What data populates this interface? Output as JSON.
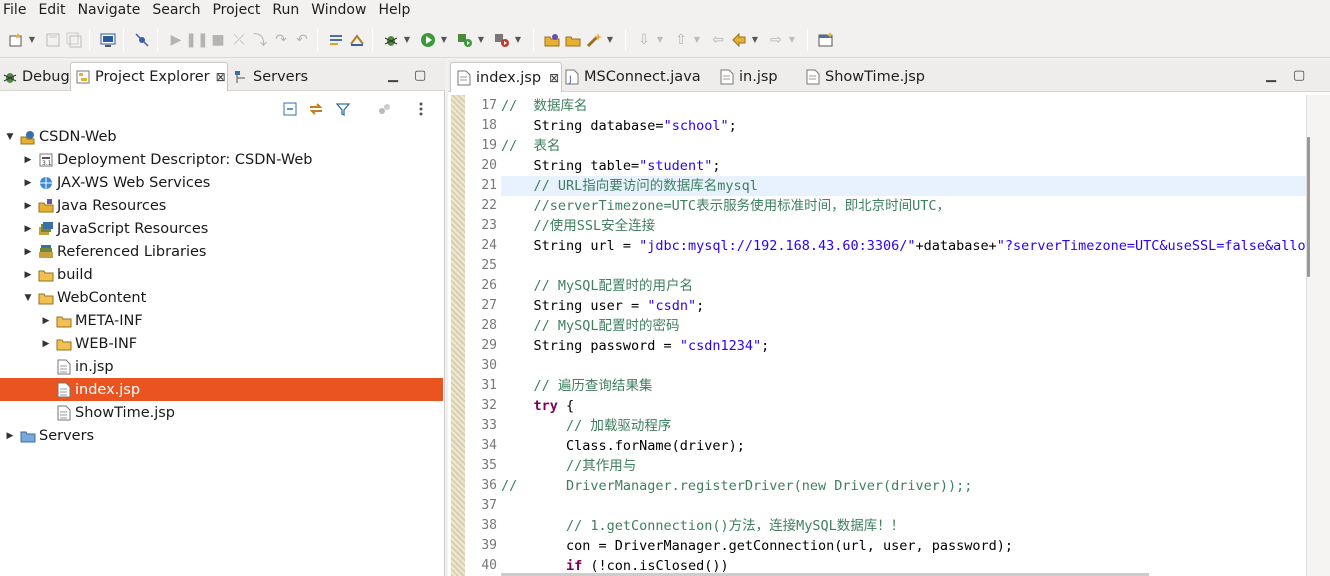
{
  "menubar": [
    "File",
    "Edit",
    "Navigate",
    "Search",
    "Project",
    "Run",
    "Window",
    "Help"
  ],
  "left_panel": {
    "tabs": [
      {
        "label": "Debug",
        "icon": "debug-icon"
      },
      {
        "label": "Project Explorer",
        "icon": "project-explorer-icon",
        "close": "⊠"
      },
      {
        "label": "Servers",
        "icon": "servers-icon"
      }
    ],
    "tree": [
      {
        "label": "CSDN-Web",
        "depth": 0,
        "arrow": "▼",
        "icon": "web-project-icon"
      },
      {
        "label": "Deployment Descriptor: CSDN-Web",
        "depth": 1,
        "arrow": "▶",
        "icon": "deployment-descriptor-icon"
      },
      {
        "label": "JAX-WS Web Services",
        "depth": 1,
        "arrow": "▶",
        "icon": "web-services-icon"
      },
      {
        "label": "Java Resources",
        "depth": 1,
        "arrow": "▶",
        "icon": "java-resources-icon"
      },
      {
        "label": "JavaScript Resources",
        "depth": 1,
        "arrow": "▶",
        "icon": "javascript-resources-icon"
      },
      {
        "label": "Referenced Libraries",
        "depth": 1,
        "arrow": "▶",
        "icon": "libraries-icon"
      },
      {
        "label": "build",
        "depth": 1,
        "arrow": "▶",
        "icon": "folder-icon"
      },
      {
        "label": "WebContent",
        "depth": 1,
        "arrow": "▼",
        "icon": "folder-icon"
      },
      {
        "label": "META-INF",
        "depth": 2,
        "arrow": "▶",
        "icon": "folder-icon"
      },
      {
        "label": "WEB-INF",
        "depth": 2,
        "arrow": "▶",
        "icon": "folder-icon"
      },
      {
        "label": "in.jsp",
        "depth": 2,
        "arrow": "",
        "icon": "file-icon"
      },
      {
        "label": "index.jsp",
        "depth": 2,
        "arrow": "",
        "icon": "file-icon",
        "selected": true
      },
      {
        "label": "ShowTime.jsp",
        "depth": 2,
        "arrow": "",
        "icon": "file-icon"
      },
      {
        "label": "Servers",
        "depth": 0,
        "arrow": "▶",
        "icon": "servers-folder-icon"
      }
    ]
  },
  "editor": {
    "tabs": [
      {
        "label": "index.jsp",
        "icon": "jsp-file-icon",
        "close": "⊠",
        "active": true
      },
      {
        "label": "MSConnect.java",
        "icon": "java-file-icon"
      },
      {
        "label": "in.jsp",
        "icon": "jsp-file-icon"
      },
      {
        "label": "ShowTime.jsp",
        "icon": "jsp-file-icon"
      }
    ],
    "current_line": 21,
    "lines": [
      {
        "n": "17",
        "parts": [
          {
            "t": "cmt",
            "v": "//  数据库名"
          }
        ]
      },
      {
        "n": "18",
        "parts": [
          {
            "t": "",
            "v": "    String database="
          },
          {
            "t": "str",
            "v": "\"school\""
          },
          {
            "t": "",
            "v": ";"
          }
        ]
      },
      {
        "n": "19",
        "parts": [
          {
            "t": "cmt",
            "v": "//  表名"
          }
        ]
      },
      {
        "n": "20",
        "parts": [
          {
            "t": "",
            "v": "    String table="
          },
          {
            "t": "str",
            "v": "\"student\""
          },
          {
            "t": "",
            "v": ";"
          }
        ]
      },
      {
        "n": "21",
        "parts": [
          {
            "t": "cmt",
            "v": "    // URL指向要访问的数据库名mysql"
          }
        ]
      },
      {
        "n": "22",
        "parts": [
          {
            "t": "cmt",
            "v": "    //serverTimezone=UTC表示服务使用标准时间，即北京时间UTC，"
          }
        ]
      },
      {
        "n": "23",
        "parts": [
          {
            "t": "cmt",
            "v": "    //使用SSL安全连接"
          }
        ]
      },
      {
        "n": "24",
        "parts": [
          {
            "t": "",
            "v": "    String url = "
          },
          {
            "t": "str",
            "v": "\"jdbc:mysql://192.168.43.60:3306/\""
          },
          {
            "t": "",
            "v": "+database+"
          },
          {
            "t": "str",
            "v": "\"?serverTimezone=UTC&useSSL=false&allowP"
          }
        ]
      },
      {
        "n": "25",
        "parts": [
          {
            "t": "",
            "v": ""
          }
        ]
      },
      {
        "n": "26",
        "parts": [
          {
            "t": "cmt",
            "v": "    // MySQL配置时的用户名"
          }
        ]
      },
      {
        "n": "27",
        "parts": [
          {
            "t": "",
            "v": "    String user = "
          },
          {
            "t": "str",
            "v": "\"csdn\""
          },
          {
            "t": "",
            "v": ";"
          }
        ]
      },
      {
        "n": "28",
        "parts": [
          {
            "t": "cmt",
            "v": "    // MySQL配置时的密码"
          }
        ]
      },
      {
        "n": "29",
        "parts": [
          {
            "t": "",
            "v": "    String password = "
          },
          {
            "t": "str",
            "v": "\"csdn1234\""
          },
          {
            "t": "",
            "v": ";"
          }
        ]
      },
      {
        "n": "30",
        "parts": [
          {
            "t": "",
            "v": ""
          }
        ]
      },
      {
        "n": "31",
        "parts": [
          {
            "t": "cmt",
            "v": "    // 遍历查询结果集"
          }
        ]
      },
      {
        "n": "32",
        "parts": [
          {
            "t": "",
            "v": "    "
          },
          {
            "t": "kw",
            "v": "try"
          },
          {
            "t": "",
            "v": " {"
          }
        ]
      },
      {
        "n": "33",
        "parts": [
          {
            "t": "cmt",
            "v": "        // 加载驱动程序"
          }
        ]
      },
      {
        "n": "34",
        "parts": [
          {
            "t": "",
            "v": "        Class.forName(driver);"
          }
        ]
      },
      {
        "n": "35",
        "parts": [
          {
            "t": "cmt",
            "v": "        //其作用与"
          }
        ]
      },
      {
        "n": "36",
        "parts": [
          {
            "t": "cmt",
            "v": "//      DriverManager.registerDriver(new Driver(driver));;"
          }
        ]
      },
      {
        "n": "37",
        "parts": [
          {
            "t": "",
            "v": ""
          }
        ]
      },
      {
        "n": "38",
        "parts": [
          {
            "t": "cmt",
            "v": "        // 1.getConnection()方法，连接MySQL数据库！！"
          }
        ]
      },
      {
        "n": "39",
        "parts": [
          {
            "t": "",
            "v": "        con = DriverManager.getConnection(url, user, password);"
          }
        ]
      },
      {
        "n": "40",
        "parts": [
          {
            "t": "",
            "v": "        "
          },
          {
            "t": "kw",
            "v": "if"
          },
          {
            "t": "",
            "v": " (!con.isClosed())"
          }
        ]
      }
    ]
  },
  "colors": {
    "selection": "#e95420",
    "comment": "#3f7f5f",
    "string": "#2a00ff",
    "keyword": "#7f0055",
    "current_line": "#e8f2fe"
  }
}
